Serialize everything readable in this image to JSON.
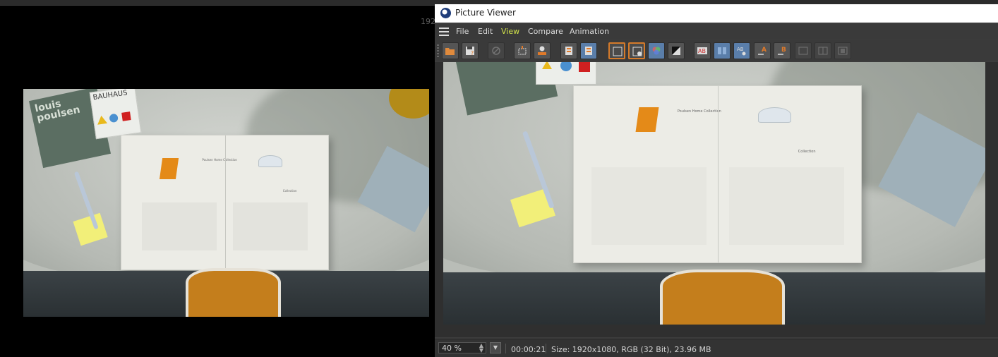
{
  "background": {
    "corner_label": "192"
  },
  "picture_viewer": {
    "title": "Picture Viewer",
    "menu": [
      "File",
      "Edit",
      "View",
      "Compare",
      "Animation"
    ],
    "active_menu": "View",
    "status": {
      "zoom": "40 %",
      "timecode": "00:00:21",
      "info": "Size: 1920x1080, RGB (32 Bit), 23.96 MB"
    }
  },
  "scene": {
    "green_book_title": "louis poulsen",
    "bauhaus_title": "BAUHAUS",
    "book_left_caption": "Poulsen Home Collection",
    "book_right_caption": "Collection"
  },
  "colors": {
    "accent_orange": "#d47a2a",
    "active_menu": "#cfe04a",
    "chair_orange": "#e48a18"
  }
}
